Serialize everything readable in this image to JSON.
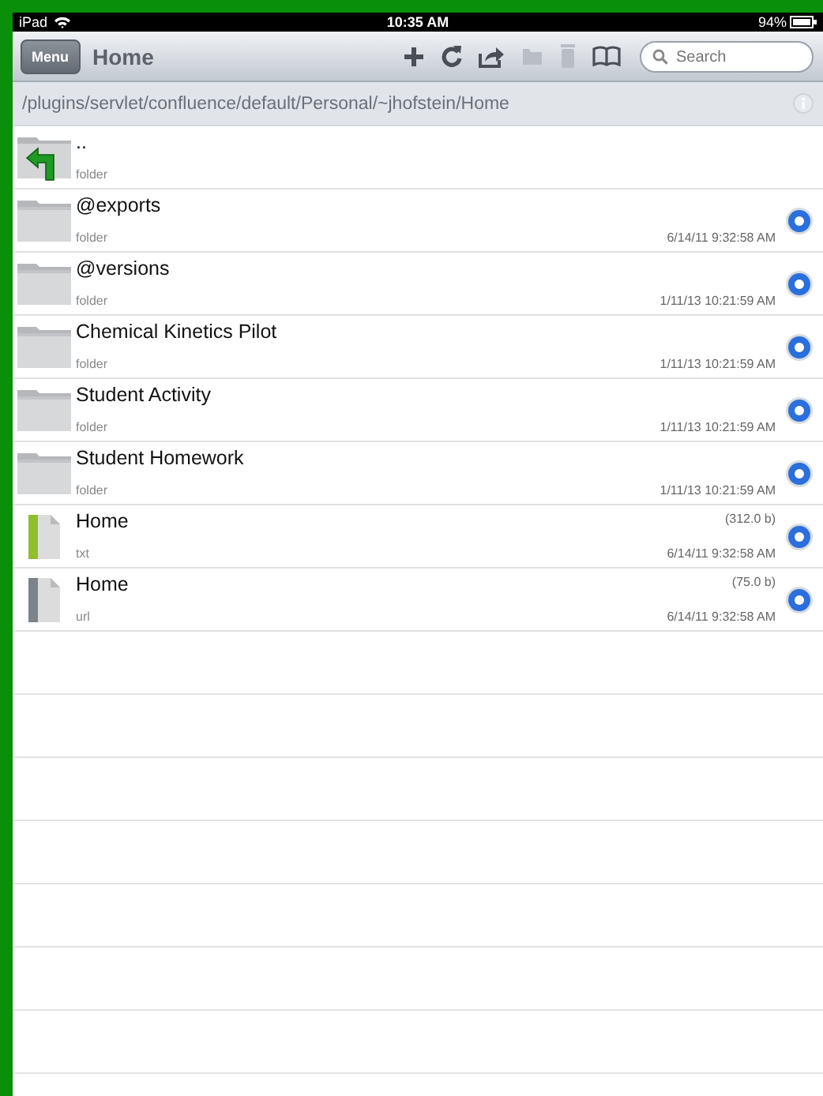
{
  "status_bar": {
    "device": "iPad",
    "time": "10:35 AM",
    "battery": "94%"
  },
  "toolbar": {
    "menu_button": "Menu",
    "title": "Home",
    "search": {
      "placeholder": "Search"
    },
    "actions": [
      {
        "kind": "add",
        "disabled": false
      },
      {
        "kind": "refresh",
        "disabled": false
      },
      {
        "kind": "share",
        "disabled": false
      },
      {
        "kind": "folder",
        "disabled": true
      },
      {
        "kind": "trash",
        "disabled": true
      },
      {
        "kind": "book",
        "disabled": false
      }
    ]
  },
  "path_bar": {
    "path": "/plugins/servlet/confluence/default/Personal/~jhofstein/Home"
  },
  "files": [
    {
      "kind": "up",
      "name": "..",
      "type": "folder"
    },
    {
      "kind": "folder",
      "name": "@exports",
      "type": "folder",
      "date": "6/14/11 9:32:58 AM"
    },
    {
      "kind": "folder",
      "name": "@versions",
      "type": "folder",
      "date": "1/11/13 10:21:59 AM"
    },
    {
      "kind": "folder",
      "name": "Chemical Kinetics Pilot",
      "type": "folder",
      "date": "1/11/13 10:21:59 AM"
    },
    {
      "kind": "folder",
      "name": "Student Activity",
      "type": "folder",
      "date": "1/11/13 10:21:59 AM"
    },
    {
      "kind": "folder",
      "name": "Student Homework",
      "type": "folder",
      "date": "1/11/13 10:21:59 AM"
    },
    {
      "kind": "txt",
      "name": "Home",
      "type": "txt",
      "size": "(312.0 b)",
      "date": "6/14/11 9:32:58 AM"
    },
    {
      "kind": "url",
      "name": "Home",
      "type": "url",
      "size": "(75.0 b)",
      "date": "6/14/11 9:32:58 AM"
    }
  ]
}
